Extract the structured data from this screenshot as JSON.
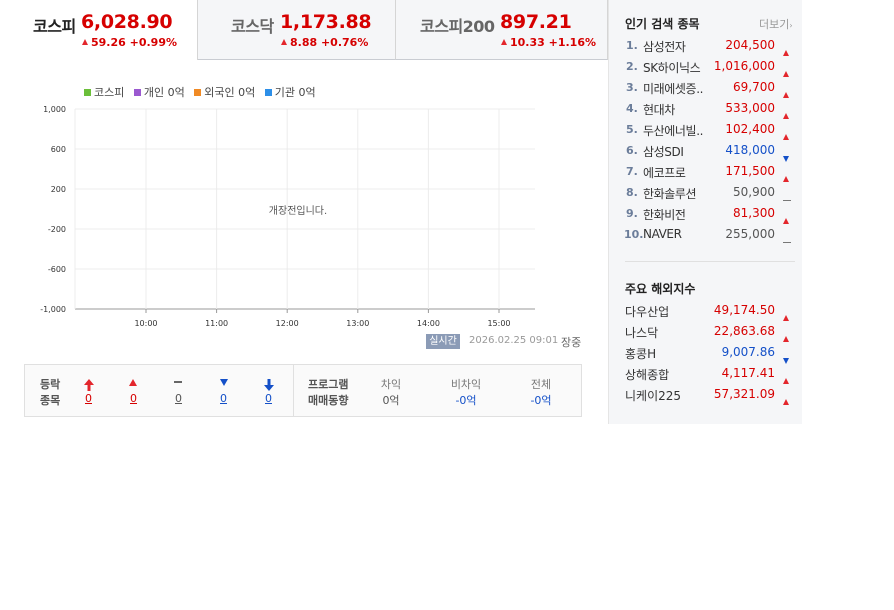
{
  "tabs": [
    {
      "name": "코스피",
      "value": "6,028.90",
      "change": "59.26 +0.99%",
      "direction": "up",
      "active": true
    },
    {
      "name": "코스닥",
      "value": "1,173.88",
      "change": "8.88 +0.76%",
      "direction": "up",
      "active": false
    },
    {
      "name": "코스피200",
      "value": "897.21",
      "change": "10.33 +1.16%",
      "direction": "up",
      "active": false
    }
  ],
  "legend": [
    {
      "label": "코스피",
      "color": "#6bbf3a"
    },
    {
      "label": "개인 0억",
      "color": "#9b59d0"
    },
    {
      "label": "외국인 0억",
      "color": "#f08a24"
    },
    {
      "label": "기관 0억",
      "color": "#2d8fe8"
    }
  ],
  "chart": {
    "y_ticks": [
      "1,000",
      "600",
      "200",
      "-200",
      "-600",
      "-1,000"
    ],
    "x_ticks": [
      "10:00",
      "11:00",
      "12:00",
      "13:00",
      "14:00",
      "15:00"
    ],
    "message": "개장전입니다."
  },
  "chart_data": {
    "type": "line",
    "y_ticks": [
      1000,
      600,
      200,
      -200,
      -600,
      -1000
    ],
    "x_ticks": [
      "10:00",
      "11:00",
      "12:00",
      "13:00",
      "14:00",
      "15:00"
    ],
    "ylim": [
      -1000,
      1000
    ],
    "series": [],
    "annotation": "개장전입니다."
  },
  "status": {
    "badge": "실시간",
    "timestamp": "2026.02.25 09:01",
    "market_state": "장중"
  },
  "breadth": {
    "title1": "등락",
    "title2": "종목",
    "counts": [
      "0",
      "0",
      "0",
      "0",
      "0"
    ],
    "program_title1": "프로그램",
    "program_title2": "매매동향",
    "program_headers": [
      "차익",
      "비차익",
      "전체"
    ],
    "program_values": [
      "0억",
      "-0억",
      "-0억"
    ]
  },
  "popular": {
    "title": "인기 검색 종목",
    "more": "더보기",
    "items": [
      {
        "rank": "1.",
        "name": "삼성전자",
        "price": "204,500",
        "dir": "up"
      },
      {
        "rank": "2.",
        "name": "SK하이닉스",
        "price": "1,016,000",
        "dir": "up"
      },
      {
        "rank": "3.",
        "name": "미래에셋증..",
        "price": "69,700",
        "dir": "up"
      },
      {
        "rank": "4.",
        "name": "현대차",
        "price": "533,000",
        "dir": "up"
      },
      {
        "rank": "5.",
        "name": "두산에너빌..",
        "price": "102,400",
        "dir": "up"
      },
      {
        "rank": "6.",
        "name": "삼성SDI",
        "price": "418,000",
        "dir": "down"
      },
      {
        "rank": "7.",
        "name": "에코프로",
        "price": "171,500",
        "dir": "up"
      },
      {
        "rank": "8.",
        "name": "한화솔루션",
        "price": "50,900",
        "dir": "flat"
      },
      {
        "rank": "9.",
        "name": "한화비전",
        "price": "81,300",
        "dir": "up"
      },
      {
        "rank": "10.",
        "name": "NAVER",
        "price": "255,000",
        "dir": "flat"
      }
    ]
  },
  "overseas": {
    "title": "주요 해외지수",
    "items": [
      {
        "name": "다우산업",
        "price": "49,174.50",
        "dir": "up"
      },
      {
        "name": "나스닥",
        "price": "22,863.68",
        "dir": "up"
      },
      {
        "name": "홍콩H",
        "price": "9,007.86",
        "dir": "down"
      },
      {
        "name": "상해종합",
        "price": "4,117.41",
        "dir": "up"
      },
      {
        "name": "니케이225",
        "price": "57,321.09",
        "dir": "up"
      }
    ]
  }
}
